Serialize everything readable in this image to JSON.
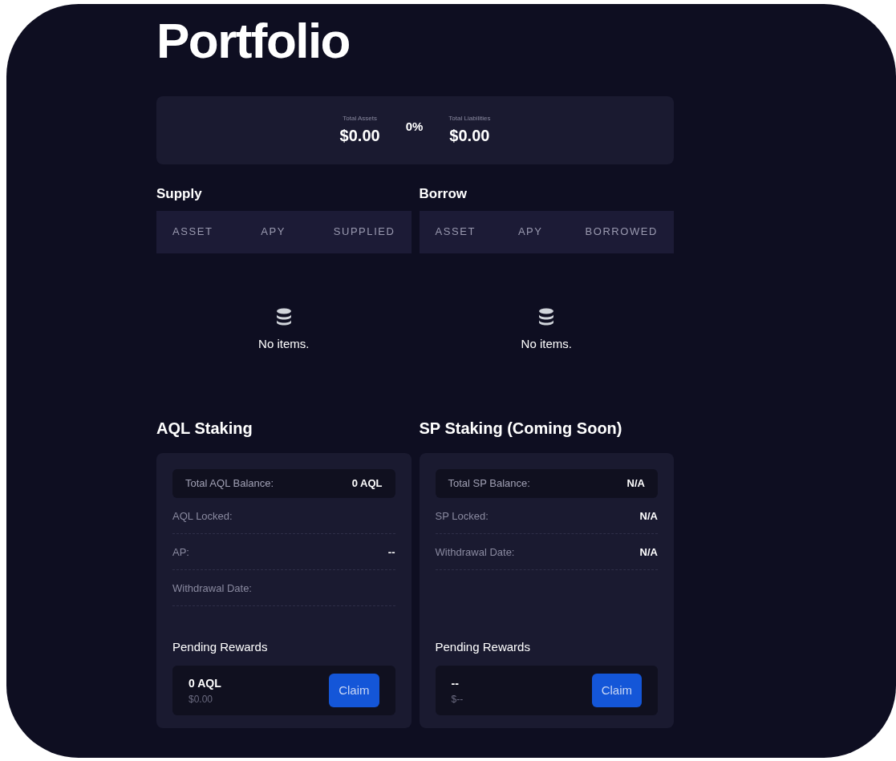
{
  "title": "Portfolio",
  "summary": {
    "assets_label": "Total Assets",
    "assets": "$0.00",
    "ratio": "0%",
    "liabilities_label": "Total Liabilities",
    "liabilities": "$0.00"
  },
  "tables": [
    {
      "title": "Supply",
      "columns": [
        "ASSET",
        "APY",
        "SUPPLIED"
      ],
      "empty_text": "No items."
    },
    {
      "title": "Borrow",
      "columns": [
        "ASSET",
        "APY",
        "BORROWED"
      ],
      "empty_text": "No items."
    }
  ],
  "staking": [
    {
      "title": "AQL Staking",
      "balance_label": "Total AQL Balance:",
      "balance": "0 AQL",
      "rows": [
        {
          "label": "AQL Locked:"
        },
        {
          "label": "AP:",
          "value": "--"
        },
        {
          "label": "Withdrawal Date:"
        }
      ],
      "rewards_label": "Pending Rewards",
      "reward": "0 AQL",
      "reward_usd": "$0.00",
      "button": "Claim"
    },
    {
      "title": "SP Staking (Coming Soon)",
      "balance_label": "Total SP Balance:",
      "balance": "N/A",
      "rows": [
        {
          "label": "SP Locked:",
          "value": "N/A"
        },
        {
          "label": "Withdrawal Date:",
          "value": "N/A"
        }
      ],
      "rewards_label": "Pending Rewards",
      "reward": "--",
      "reward_usd": "$--",
      "button": "Claim"
    }
  ]
}
